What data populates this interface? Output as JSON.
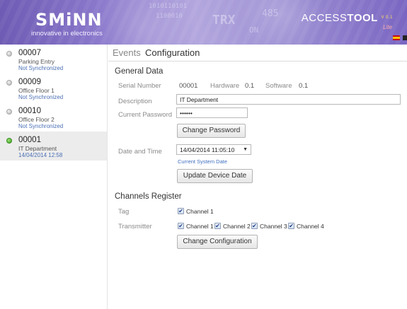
{
  "header": {
    "logo": "SMiNN",
    "tagline": "innovative in electronics",
    "product_prefix": "ACCESS",
    "product_suffix": "TOOL",
    "version": "V 0.1",
    "edition": "Lite",
    "deco_text_1": "TRX",
    "deco_text_2": "485",
    "deco_text_3": "ON",
    "deco_text_4": "1010110101",
    "deco_text_5": "1100010"
  },
  "devices": [
    {
      "id": "00007",
      "name": "Parking Entry",
      "status": "Not Synchronized",
      "online": false
    },
    {
      "id": "00009",
      "name": "Office Floor 1",
      "status": "Not Synchronized",
      "online": false
    },
    {
      "id": "00010",
      "name": "Office Floor 2",
      "status": "Not Synchronized",
      "online": false
    },
    {
      "id": "00001",
      "name": "IT Department",
      "status": "14/04/2014 12:58",
      "online": true
    }
  ],
  "tabs": {
    "events": "Events",
    "configuration": "Configuration"
  },
  "general": {
    "title": "General Data",
    "serial_label": "Serial Number",
    "serial_value": "00001",
    "hardware_label": "Hardware",
    "hardware_value": "0.1",
    "software_label": "Software",
    "software_value": "0.1",
    "description_label": "Description",
    "description_value": "IT Department",
    "password_label": "Current Password",
    "password_value": "••••••",
    "change_password_button": "Change Password",
    "date_label": "Date and Time",
    "date_value": "14/04/2014 11:05:10",
    "current_system_date_link": "Current System Date",
    "update_date_button": "Update Device Date"
  },
  "channels": {
    "title": "Channels Register",
    "tag_label": "Tag",
    "transmitter_label": "Transmitter",
    "tag_channels": [
      "Channel 1"
    ],
    "transmitter_channels": [
      "Channel 1",
      "Channel 2",
      "Channel 3",
      "Channel 4"
    ],
    "checkmark": "✔",
    "change_config_button": "Change Configuration"
  },
  "colors": {
    "header_accent": "#7a66c2",
    "link": "#3f6fbf",
    "online": "#3aa01e"
  }
}
